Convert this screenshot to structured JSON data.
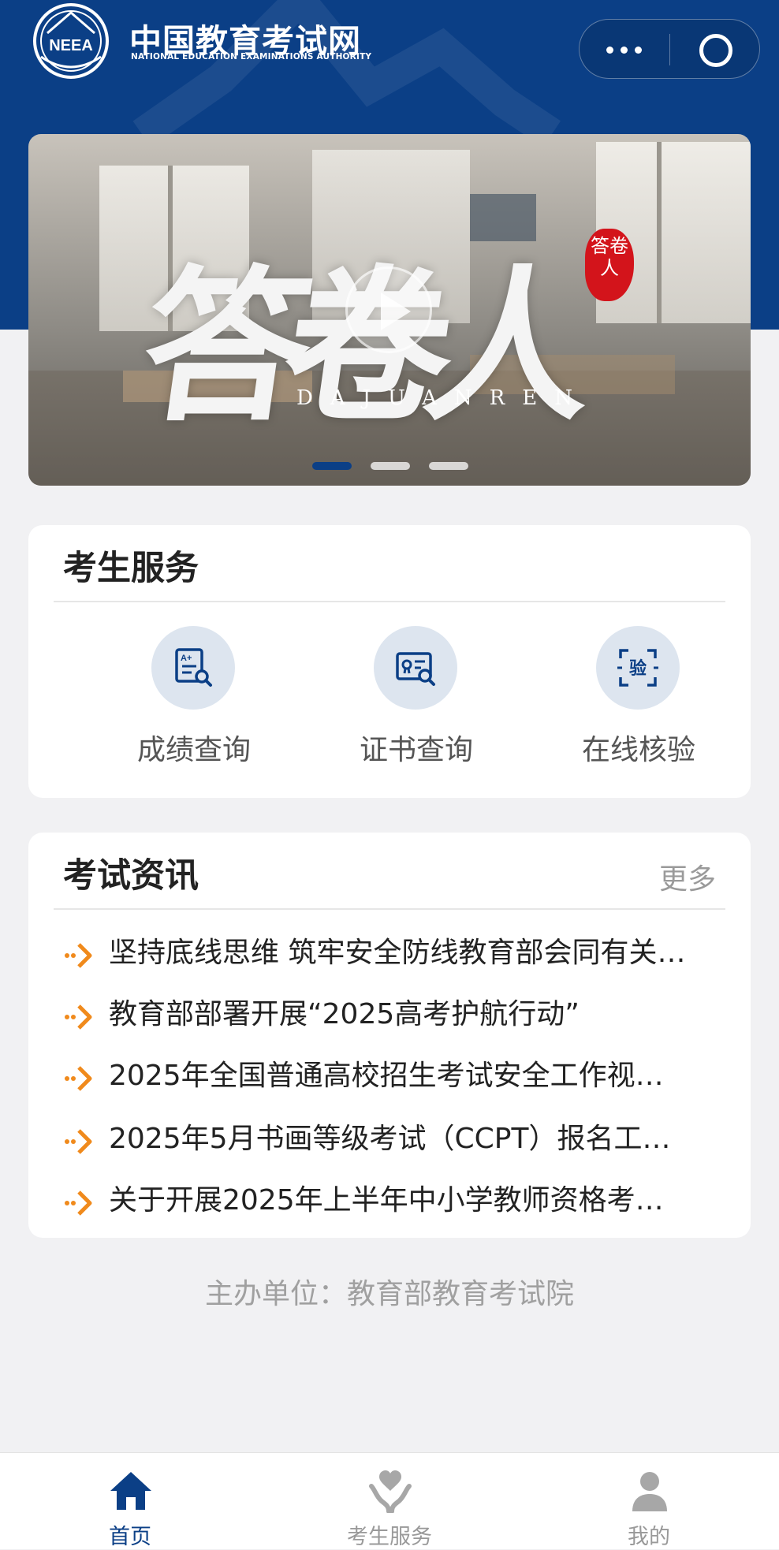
{
  "header": {
    "logo_mark": "NEEA",
    "title_cn": "中国教育考试网",
    "title_en": "NATIONAL EDUCATION EXAMINATIONS AUTHORITY"
  },
  "banner": {
    "title_cn": "答卷人",
    "title_en": "DAJUANREN",
    "seal": "答卷人",
    "slides": 3,
    "active_slide": 1
  },
  "services": {
    "title": "考生服务",
    "items": [
      {
        "label": "成绩查询",
        "icon": "score-search-icon"
      },
      {
        "label": "证书查询",
        "icon": "certificate-search-icon"
      },
      {
        "label": "在线核验",
        "icon": "verify-scan-icon",
        "badge": "验"
      }
    ]
  },
  "news": {
    "title": "考试资讯",
    "more": "更多",
    "items": [
      "坚持底线思维 筑牢安全防线教育部会同有关…",
      "教育部部署开展“2025高考护航行动”",
      "2025年全国普通高校招生考试安全工作视…",
      "2025年5月书画等级考试（CCPT）报名工…",
      "关于开展2025年上半年中小学教师资格考…"
    ]
  },
  "footer": {
    "organizer": "主办单位：教育部教育考试院"
  },
  "tabbar": {
    "items": [
      {
        "label": "首页",
        "icon": "home-icon",
        "active": true
      },
      {
        "label": "考生服务",
        "icon": "service-icon",
        "active": false
      },
      {
        "label": "我的",
        "icon": "user-icon",
        "active": false
      }
    ]
  },
  "colors": {
    "brand_blue": "#0b3f86",
    "accent_orange": "#f08a1c",
    "background": "#f1f1f3"
  }
}
